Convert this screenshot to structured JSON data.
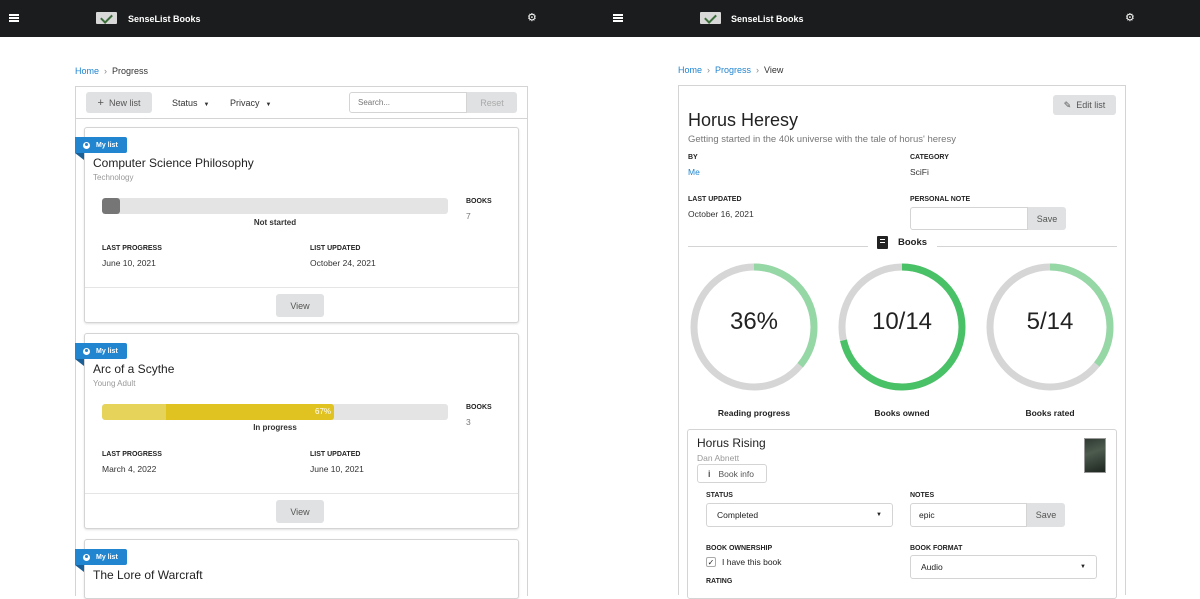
{
  "app": {
    "brand": "SenseList Books"
  },
  "left": {
    "breadcrumb": {
      "home": "Home",
      "current": "Progress"
    },
    "toolbar": {
      "new_list": "New list",
      "status": "Status",
      "privacy": "Privacy",
      "search_placeholder": "Search...",
      "reset": "Reset"
    },
    "cards": [
      {
        "ribbon": "My list",
        "title": "Computer Science Philosophy",
        "category": "Technology",
        "progress": 0,
        "progress_label": "",
        "status_text": "Not started",
        "color": "#767676",
        "books_label": "BOOKS",
        "books": "7",
        "last_progress_label": "LAST PROGRESS",
        "last_progress": "June 10, 2021",
        "list_updated_label": "LIST UPDATED",
        "list_updated": "October 24, 2021",
        "view": "View"
      },
      {
        "ribbon": "My list",
        "title": "Arc of a Scythe",
        "category": "Young Adult",
        "progress": 0.67,
        "progress_label": "67%",
        "status_text": "In progress",
        "color": "#e0c221",
        "books_label": "BOOKS",
        "books": "3",
        "last_progress_label": "LAST PROGRESS",
        "last_progress": "March 4, 2022",
        "list_updated_label": "LIST UPDATED",
        "list_updated": "June 10, 2021",
        "view": "View"
      },
      {
        "ribbon": "My list",
        "title": "The Lore of Warcraft"
      }
    ]
  },
  "right": {
    "breadcrumb": {
      "home": "Home",
      "progress": "Progress",
      "current": "View"
    },
    "edit_list": "Edit list",
    "title": "Horus Heresy",
    "subtitle": "Getting started in the 40k universe with the tale of horus' heresy",
    "by_label": "BY",
    "by": "Me",
    "category_label": "CATEGORY",
    "category": "SciFi",
    "last_updated_label": "LAST UPDATED",
    "last_updated": "October 16, 2021",
    "personal_note_label": "PERSONAL NOTE",
    "personal_note": "",
    "save": "Save",
    "books_section": "Books",
    "stats": [
      {
        "value": "36%",
        "label": "Reading progress",
        "fraction": 0.36,
        "color": "#96d7a6"
      },
      {
        "value": "10/14",
        "label": "Books owned",
        "fraction": 0.714,
        "color": "#49c167"
      },
      {
        "value": "5/14",
        "label": "Books rated",
        "fraction": 0.357,
        "color": "#96d7a6"
      }
    ],
    "book": {
      "title": "Horus Rising",
      "author": "Dan Abnett",
      "info": "Book info",
      "status_label": "STATUS",
      "status": "Completed",
      "notes_label": "NOTES",
      "notes": "epic",
      "save": "Save",
      "ownership_label": "BOOK OWNERSHIP",
      "ownership_checkbox": "I have this book",
      "owned": true,
      "format_label": "BOOK FORMAT",
      "format": "Audio",
      "rating_label": "RATING"
    }
  }
}
